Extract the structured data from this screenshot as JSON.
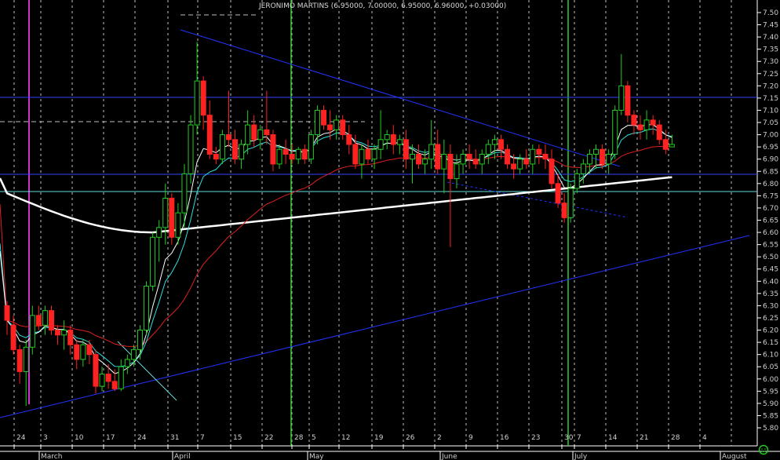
{
  "chart_data": {
    "type": "candlestick",
    "title": "JERONIMO MARTINS (6.95000, 7.00000, 6.95000, 6.96000, +0.03000)",
    "ylim": [
      5.75,
      7.5
    ],
    "yticks": [
      "7.50",
      "7.45",
      "7.40",
      "7.35",
      "7.30",
      "7.25",
      "7.20",
      "7.15",
      "7.10",
      "7.05",
      "7.00",
      "6.95",
      "6.90",
      "6.85",
      "6.80",
      "6.75",
      "6.70",
      "6.65",
      "6.60",
      "6.55",
      "6.50",
      "6.45",
      "6.40",
      "6.35",
      "6.30",
      "6.25",
      "6.20",
      "6.15",
      "6.10",
      "6.05",
      "6.00",
      "5.95",
      "5.90",
      "5.85",
      "5.80"
    ],
    "day_labels": [
      "24",
      "3",
      "10",
      "17",
      "24",
      "31",
      "7",
      "15",
      "22",
      "28",
      "5",
      "12",
      "19",
      "26",
      "2",
      "9",
      "16",
      "23",
      "30",
      "7",
      "14",
      "21",
      "28",
      "4"
    ],
    "months": [
      "March",
      "April",
      "May",
      "June",
      "July",
      "August"
    ],
    "colors": {
      "up": "#22cc22",
      "down": "#ff2222",
      "ma200": "#ffffff",
      "ma50": "#e02020",
      "ema_fast": "#ffffff",
      "ema_slow": "#33dddd",
      "trend": "#2233ff",
      "marker": "#33cc33",
      "purple": "#cc33cc"
    },
    "candles": [
      {
        "o": 6.3,
        "h": 6.32,
        "l": 6.18,
        "c": 6.24
      },
      {
        "o": 6.22,
        "h": 6.26,
        "l": 6.1,
        "c": 6.12
      },
      {
        "o": 6.12,
        "h": 6.14,
        "l": 5.98,
        "c": 6.03
      },
      {
        "o": 6.03,
        "h": 6.16,
        "l": 5.89,
        "c": 6.13
      },
      {
        "o": 6.13,
        "h": 6.3,
        "l": 6.1,
        "c": 6.26
      },
      {
        "o": 6.26,
        "h": 6.3,
        "l": 6.2,
        "c": 6.22
      },
      {
        "o": 6.22,
        "h": 6.3,
        "l": 6.18,
        "c": 6.28
      },
      {
        "o": 6.28,
        "h": 6.3,
        "l": 6.18,
        "c": 6.2
      },
      {
        "o": 6.2,
        "h": 6.22,
        "l": 6.14,
        "c": 6.18
      },
      {
        "o": 6.18,
        "h": 6.24,
        "l": 6.12,
        "c": 6.2
      },
      {
        "o": 6.2,
        "h": 6.22,
        "l": 6.1,
        "c": 6.14
      },
      {
        "o": 6.14,
        "h": 6.16,
        "l": 6.04,
        "c": 6.08
      },
      {
        "o": 6.08,
        "h": 6.16,
        "l": 6.05,
        "c": 6.14
      },
      {
        "o": 6.14,
        "h": 6.16,
        "l": 6.06,
        "c": 6.1
      },
      {
        "o": 6.1,
        "h": 6.12,
        "l": 5.94,
        "c": 5.97
      },
      {
        "o": 5.97,
        "h": 6.05,
        "l": 5.95,
        "c": 6.02
      },
      {
        "o": 6.02,
        "h": 6.06,
        "l": 5.96,
        "c": 5.99
      },
      {
        "o": 5.99,
        "h": 6.04,
        "l": 5.95,
        "c": 5.96
      },
      {
        "o": 5.96,
        "h": 6.08,
        "l": 5.95,
        "c": 6.05
      },
      {
        "o": 6.05,
        "h": 6.1,
        "l": 6.02,
        "c": 6.08
      },
      {
        "o": 6.08,
        "h": 6.14,
        "l": 6.05,
        "c": 6.12
      },
      {
        "o": 6.12,
        "h": 6.22,
        "l": 6.08,
        "c": 6.2
      },
      {
        "o": 6.2,
        "h": 6.4,
        "l": 6.18,
        "c": 6.38
      },
      {
        "o": 6.38,
        "h": 6.6,
        "l": 6.36,
        "c": 6.58
      },
      {
        "o": 6.58,
        "h": 6.65,
        "l": 6.48,
        "c": 6.62
      },
      {
        "o": 6.62,
        "h": 6.8,
        "l": 6.55,
        "c": 6.74
      },
      {
        "o": 6.74,
        "h": 6.76,
        "l": 6.55,
        "c": 6.58
      },
      {
        "o": 6.58,
        "h": 6.72,
        "l": 6.55,
        "c": 6.68
      },
      {
        "o": 6.68,
        "h": 6.88,
        "l": 6.62,
        "c": 6.84
      },
      {
        "o": 6.84,
        "h": 7.08,
        "l": 6.8,
        "c": 7.04
      },
      {
        "o": 7.04,
        "h": 7.38,
        "l": 7.0,
        "c": 7.22
      },
      {
        "o": 7.22,
        "h": 7.24,
        "l": 7.02,
        "c": 7.08
      },
      {
        "o": 7.08,
        "h": 7.14,
        "l": 6.9,
        "c": 6.92
      },
      {
        "o": 6.92,
        "h": 6.95,
        "l": 6.88,
        "c": 6.9
      },
      {
        "o": 6.9,
        "h": 7.02,
        "l": 6.88,
        "c": 7.0
      },
      {
        "o": 7.0,
        "h": 7.18,
        "l": 6.95,
        "c": 6.98
      },
      {
        "o": 6.98,
        "h": 7.02,
        "l": 6.88,
        "c": 6.9
      },
      {
        "o": 6.9,
        "h": 6.98,
        "l": 6.86,
        "c": 6.96
      },
      {
        "o": 6.96,
        "h": 7.1,
        "l": 6.92,
        "c": 7.04
      },
      {
        "o": 7.04,
        "h": 7.08,
        "l": 6.95,
        "c": 6.98
      },
      {
        "o": 6.98,
        "h": 7.04,
        "l": 6.94,
        "c": 7.02
      },
      {
        "o": 7.02,
        "h": 7.18,
        "l": 6.96,
        "c": 7.0
      },
      {
        "o": 7.0,
        "h": 7.02,
        "l": 6.85,
        "c": 6.88
      },
      {
        "o": 6.88,
        "h": 6.96,
        "l": 6.86,
        "c": 6.94
      },
      {
        "o": 6.94,
        "h": 6.98,
        "l": 6.88,
        "c": 6.92
      },
      {
        "o": 6.92,
        "h": 6.96,
        "l": 6.88,
        "c": 6.9
      },
      {
        "o": 6.9,
        "h": 6.95,
        "l": 6.88,
        "c": 6.94
      },
      {
        "o": 6.94,
        "h": 6.96,
        "l": 6.88,
        "c": 6.9
      },
      {
        "o": 6.9,
        "h": 7.02,
        "l": 6.88,
        "c": 7.0
      },
      {
        "o": 7.0,
        "h": 7.12,
        "l": 6.96,
        "c": 7.1
      },
      {
        "o": 7.1,
        "h": 7.12,
        "l": 7.02,
        "c": 7.04
      },
      {
        "o": 7.04,
        "h": 7.1,
        "l": 6.98,
        "c": 7.02
      },
      {
        "o": 7.02,
        "h": 7.08,
        "l": 6.98,
        "c": 7.06
      },
      {
        "o": 7.06,
        "h": 7.08,
        "l": 6.98,
        "c": 7.0
      },
      {
        "o": 7.0,
        "h": 7.04,
        "l": 6.92,
        "c": 6.96
      },
      {
        "o": 6.96,
        "h": 7.0,
        "l": 6.86,
        "c": 6.88
      },
      {
        "o": 6.88,
        "h": 6.96,
        "l": 6.82,
        "c": 6.94
      },
      {
        "o": 6.94,
        "h": 6.98,
        "l": 6.88,
        "c": 6.9
      },
      {
        "o": 6.9,
        "h": 6.96,
        "l": 6.86,
        "c": 6.94
      },
      {
        "o": 6.94,
        "h": 7.1,
        "l": 6.9,
        "c": 6.98
      },
      {
        "o": 6.98,
        "h": 7.02,
        "l": 6.94,
        "c": 7.0
      },
      {
        "o": 7.0,
        "h": 7.04,
        "l": 6.92,
        "c": 6.96
      },
      {
        "o": 6.96,
        "h": 7.0,
        "l": 6.92,
        "c": 6.98
      },
      {
        "o": 6.98,
        "h": 7.02,
        "l": 6.86,
        "c": 6.9
      },
      {
        "o": 6.9,
        "h": 6.96,
        "l": 6.8,
        "c": 6.92
      },
      {
        "o": 6.92,
        "h": 6.96,
        "l": 6.86,
        "c": 6.88
      },
      {
        "o": 6.88,
        "h": 6.94,
        "l": 6.84,
        "c": 6.9
      },
      {
        "o": 6.9,
        "h": 7.06,
        "l": 6.86,
        "c": 6.96
      },
      {
        "o": 6.96,
        "h": 7.02,
        "l": 6.84,
        "c": 6.86
      },
      {
        "o": 6.86,
        "h": 6.98,
        "l": 6.76,
        "c": 6.92
      },
      {
        "o": 6.92,
        "h": 6.96,
        "l": 6.54,
        "c": 6.82
      },
      {
        "o": 6.82,
        "h": 6.92,
        "l": 6.78,
        "c": 6.88
      },
      {
        "o": 6.88,
        "h": 6.94,
        "l": 6.84,
        "c": 6.92
      },
      {
        "o": 6.92,
        "h": 6.96,
        "l": 6.86,
        "c": 6.9
      },
      {
        "o": 6.9,
        "h": 6.94,
        "l": 6.86,
        "c": 6.88
      },
      {
        "o": 6.88,
        "h": 6.94,
        "l": 6.84,
        "c": 6.92
      },
      {
        "o": 6.92,
        "h": 6.98,
        "l": 6.88,
        "c": 6.96
      },
      {
        "o": 6.96,
        "h": 7.0,
        "l": 6.9,
        "c": 6.98
      },
      {
        "o": 6.98,
        "h": 7.0,
        "l": 6.9,
        "c": 6.94
      },
      {
        "o": 6.94,
        "h": 6.96,
        "l": 6.86,
        "c": 6.88
      },
      {
        "o": 6.88,
        "h": 6.92,
        "l": 6.82,
        "c": 6.86
      },
      {
        "o": 6.86,
        "h": 6.92,
        "l": 6.84,
        "c": 6.9
      },
      {
        "o": 6.9,
        "h": 6.94,
        "l": 6.86,
        "c": 6.88
      },
      {
        "o": 6.88,
        "h": 6.96,
        "l": 6.84,
        "c": 6.94
      },
      {
        "o": 6.94,
        "h": 6.96,
        "l": 6.88,
        "c": 6.92
      },
      {
        "o": 6.92,
        "h": 6.96,
        "l": 6.86,
        "c": 6.9
      },
      {
        "o": 6.9,
        "h": 6.94,
        "l": 6.78,
        "c": 6.8
      },
      {
        "o": 6.8,
        "h": 6.84,
        "l": 6.7,
        "c": 6.72
      },
      {
        "o": 6.72,
        "h": 6.76,
        "l": 6.64,
        "c": 6.66
      },
      {
        "o": 6.66,
        "h": 6.8,
        "l": 6.64,
        "c": 6.78
      },
      {
        "o": 6.78,
        "h": 6.86,
        "l": 6.76,
        "c": 6.84
      },
      {
        "o": 6.84,
        "h": 6.9,
        "l": 6.8,
        "c": 6.88
      },
      {
        "o": 6.88,
        "h": 6.94,
        "l": 6.84,
        "c": 6.92
      },
      {
        "o": 6.92,
        "h": 6.96,
        "l": 6.86,
        "c": 6.94
      },
      {
        "o": 6.94,
        "h": 6.96,
        "l": 6.86,
        "c": 6.88
      },
      {
        "o": 6.88,
        "h": 6.94,
        "l": 6.84,
        "c": 6.92
      },
      {
        "o": 6.92,
        "h": 7.12,
        "l": 6.9,
        "c": 7.1
      },
      {
        "o": 7.1,
        "h": 7.33,
        "l": 7.08,
        "c": 7.2
      },
      {
        "o": 7.2,
        "h": 7.22,
        "l": 7.05,
        "c": 7.08
      },
      {
        "o": 7.08,
        "h": 7.1,
        "l": 7.0,
        "c": 7.04
      },
      {
        "o": 7.04,
        "h": 7.08,
        "l": 6.98,
        "c": 7.02
      },
      {
        "o": 7.02,
        "h": 7.1,
        "l": 6.98,
        "c": 7.06
      },
      {
        "o": 7.06,
        "h": 7.08,
        "l": 7.0,
        "c": 7.04
      },
      {
        "o": 7.04,
        "h": 7.06,
        "l": 6.96,
        "c": 6.98
      },
      {
        "o": 6.98,
        "h": 7.02,
        "l": 6.92,
        "c": 6.94
      },
      {
        "o": 6.95,
        "h": 7.0,
        "l": 6.95,
        "c": 6.96
      }
    ]
  }
}
